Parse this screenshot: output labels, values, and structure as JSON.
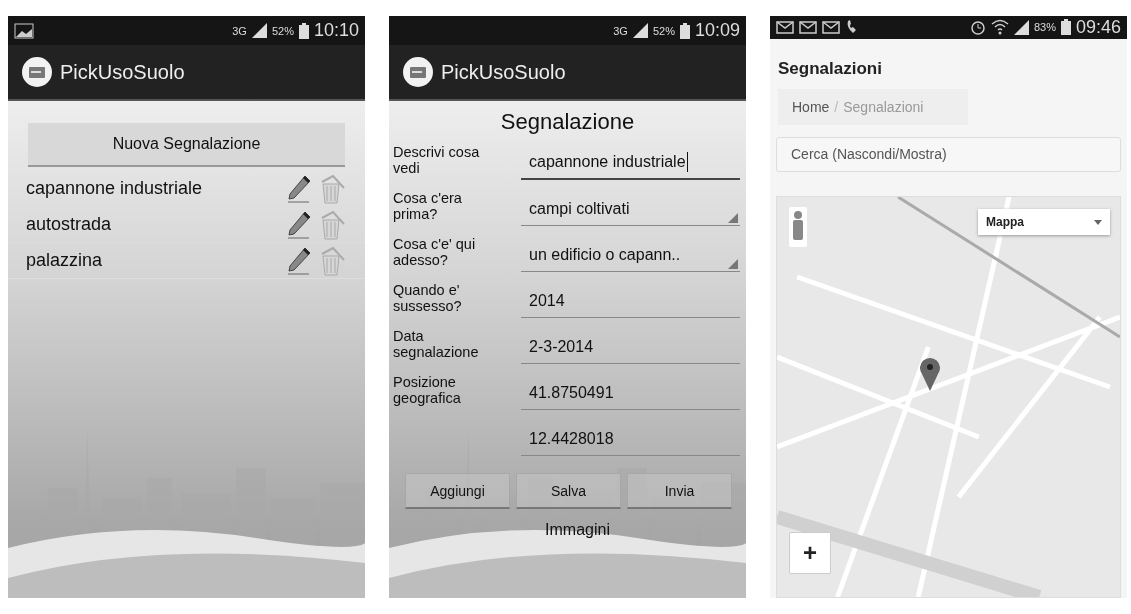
{
  "list_screen": {
    "status_bar": {
      "network": "3G",
      "battery": "52%",
      "time": "10:10"
    },
    "app_title": "PickUsoSuolo",
    "new_button": "Nuova Segnalazione",
    "items": [
      {
        "label": "capannone industriale"
      },
      {
        "label": "autostrada"
      },
      {
        "label": "palazzina"
      }
    ]
  },
  "form_screen": {
    "status_bar": {
      "network": "3G",
      "battery": "52%",
      "time": "10:09"
    },
    "app_title": "PickUsoSuolo",
    "title": "Segnalazione",
    "fields": [
      {
        "label": "Descrivi cosa vedi",
        "value": "capannone industriale",
        "kind": "text",
        "focused": true
      },
      {
        "label": "Cosa c'era prima?",
        "value": "campi coltivati",
        "kind": "select"
      },
      {
        "label": "Cosa c'e' qui adesso?",
        "value": "un edificio o  capann..",
        "kind": "select"
      },
      {
        "label": "Quando e' sussesso?",
        "value": "2014",
        "kind": "text",
        "focused": false
      },
      {
        "label": "Data segnalazione",
        "value": "2-3-2014",
        "kind": "text",
        "focused": false
      },
      {
        "label": "Posizione geografica",
        "value": "41.8750491",
        "kind": "text",
        "focused": false
      },
      {
        "value": "12.4428018",
        "kind": "text",
        "focused": false
      }
    ],
    "buttons": [
      "Aggiungi",
      "Salva",
      "Invia"
    ],
    "images_label": "Immagini"
  },
  "web_screen": {
    "status_bar": {
      "battery": "83%",
      "time": "09:46"
    },
    "title": "Segnalazioni",
    "breadcrumb_separator": "/",
    "breadcrumb": [
      {
        "label": "Home",
        "selected": false
      },
      {
        "label": "Segnalazioni",
        "selected": true
      }
    ],
    "search_panel": "Cerca (Nascondi/Mostra)",
    "map": {
      "type_select": "Mappa",
      "zoom_in": "+"
    }
  }
}
